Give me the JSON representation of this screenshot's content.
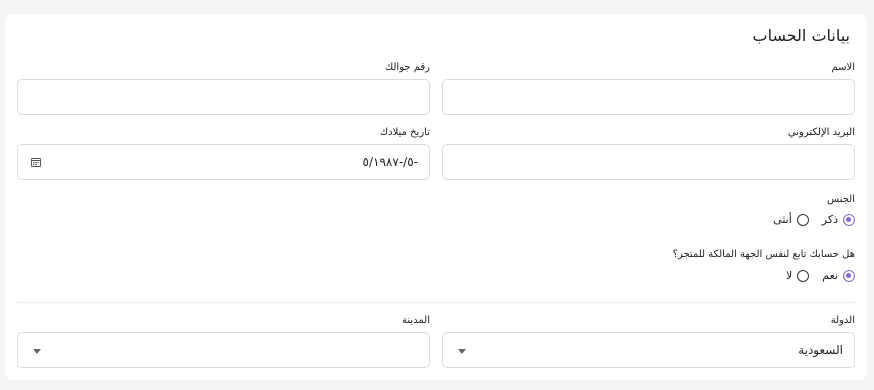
{
  "section": {
    "title": "بيانات الحساب"
  },
  "fields": {
    "name": {
      "label": "الاسم",
      "value": ""
    },
    "mobile": {
      "label": "رقم جوالك",
      "value": ""
    },
    "email": {
      "label": "البريد الإلكتروني",
      "value": ""
    },
    "birthdate": {
      "label": "تاريخ ميلادك",
      "value": "-٥/-٥/١٩٨٧"
    },
    "gender": {
      "label": "الجنس",
      "options": [
        "ذكر",
        "أنثى"
      ],
      "selected": "ذكر"
    },
    "store_owner": {
      "label": "هل حسابك تابع لنفس الجهة المالكة للمتجر؟",
      "options": [
        "نعم",
        "لا"
      ],
      "selected": "نعم"
    },
    "country": {
      "label": "الدولة",
      "value": "السعودية"
    },
    "city": {
      "label": "المدينة",
      "value": ""
    }
  },
  "colors": {
    "accent": "#8a63d2",
    "border": "#dcdcde",
    "background": "#f5f5f6"
  },
  "icons": {
    "calendar": "calendar-icon",
    "dropdown": "chevron-down-icon"
  }
}
